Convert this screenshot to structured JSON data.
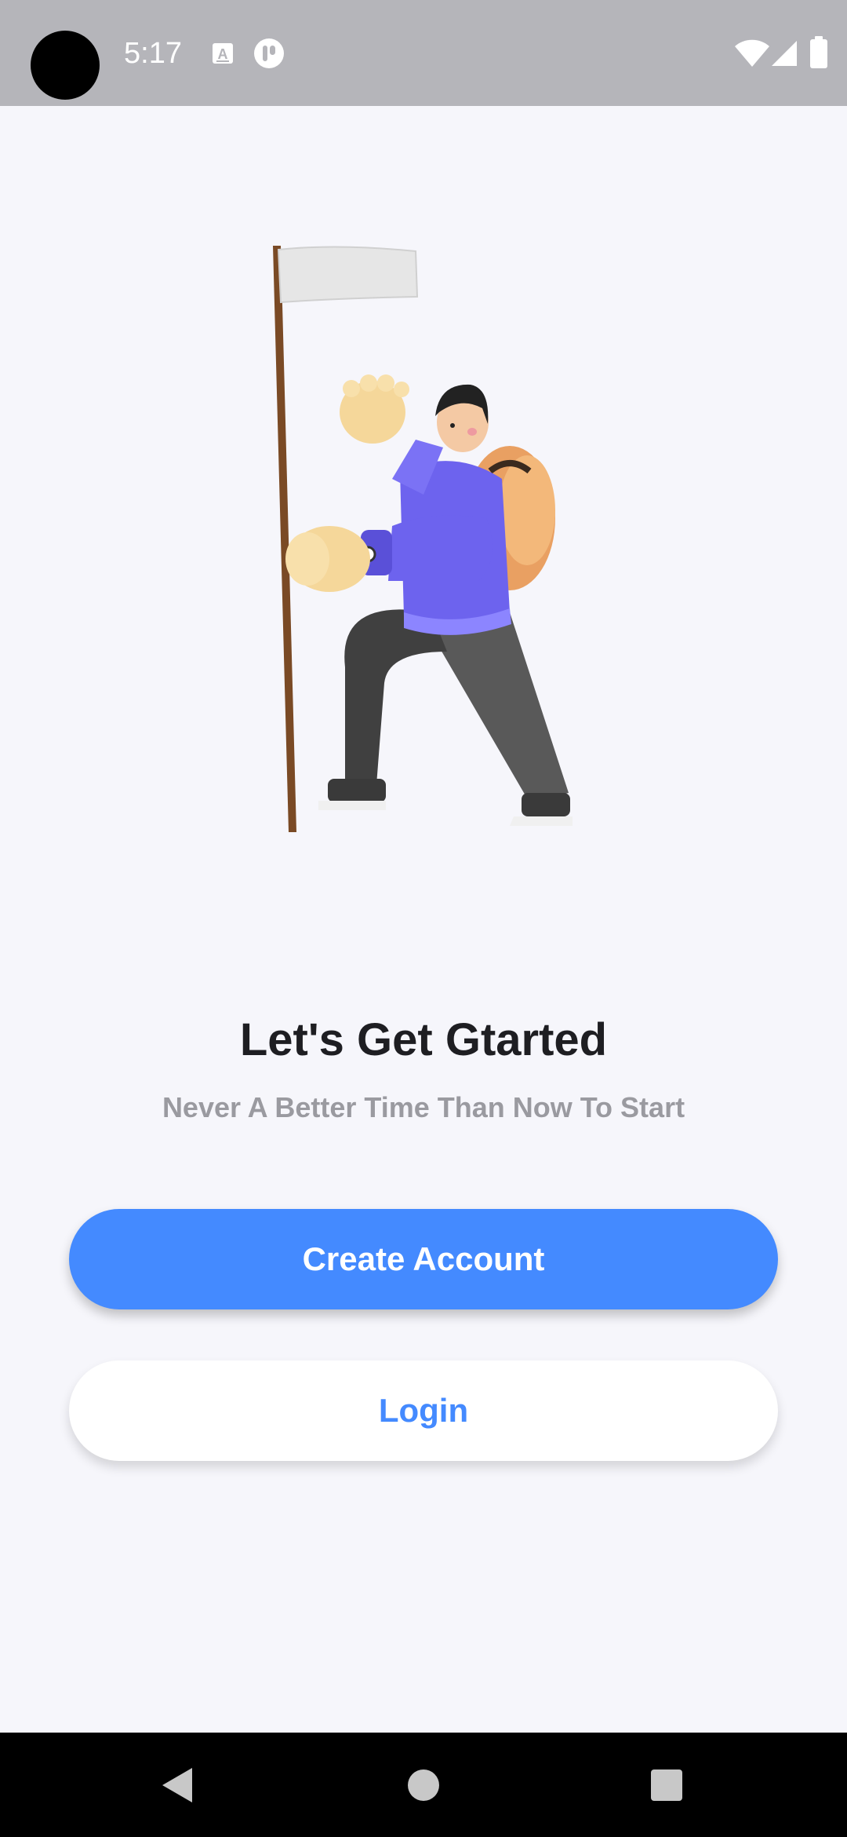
{
  "status_bar": {
    "time": "5:17",
    "icons": [
      "camera-cutout",
      "keyboard-a-icon",
      "app-notification-icon",
      "wifi-icon",
      "cell-signal-icon",
      "battery-icon"
    ]
  },
  "onboarding": {
    "title": "Let's Get Gtarted",
    "subtitle": "Never A Better Time Than Now To Start",
    "create_account_label": "Create Account",
    "login_label": "Login"
  },
  "navigation": {
    "icons": [
      "back-icon",
      "home-icon",
      "recents-icon"
    ]
  },
  "colors": {
    "accent": "#448aff",
    "background": "#f6f6fb",
    "status_bar": "#b5b5ba",
    "title": "#1e1e22",
    "subtitle": "#9a9aa0"
  }
}
